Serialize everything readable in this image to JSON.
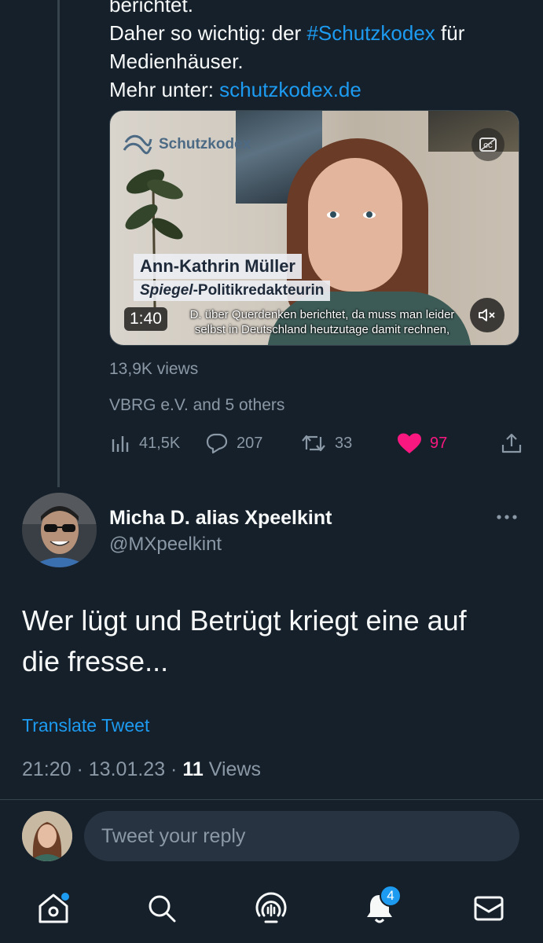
{
  "previous_tweet": {
    "text_lines": [
      "berichtet.",
      "Daher so wichtig: der ",
      "Medienhäuser.",
      "Mehr unter: "
    ],
    "hashtag": "#Schutzkodex",
    "after_hashtag": " für",
    "link": "schutzkodex.de",
    "video": {
      "brand": "Schutzkodex",
      "lower_third_name": "Ann-Kathrin Müller",
      "lower_third_role_italic": "Spiegel",
      "lower_third_role_rest": "-Politikredakteurin",
      "subtitle_line1": "D. über Querdenken berichtet, da muss man leider",
      "subtitle_line2": "selbst in Deutschland heutzutage damit rechnen,",
      "duration": "1:40"
    },
    "views": "13,9K views",
    "liked_by": "VBRG e.V. and 5 others",
    "stats": {
      "analytics": "41,5K",
      "replies": "207",
      "retweets": "33",
      "likes": "97"
    },
    "like_color": "#f91880"
  },
  "reply_tweet": {
    "author_name": "Micha D. alias Xpeelkint",
    "author_handle": "@MXpeelkint",
    "text_line1": "Wer lügt und Betrügt kriegt eine auf",
    "text_line2": "die fresse...",
    "translate_label": "Translate Tweet",
    "time": "21:20",
    "date": "13.01.23",
    "views_count": "11",
    "views_label": "Views",
    "separator": " · "
  },
  "composer": {
    "placeholder": "Tweet your reply"
  },
  "tabbar": {
    "notifications_badge": "4",
    "accent": "#1d9bf0",
    "icons": [
      "home-icon",
      "search-icon",
      "spaces-icon",
      "notifications-icon",
      "messages-icon"
    ]
  }
}
